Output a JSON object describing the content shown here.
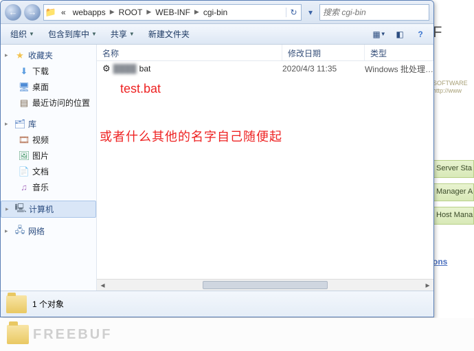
{
  "window": {
    "breadcrumb": {
      "pre": "«",
      "seg1": "webapps",
      "seg2": "ROOT",
      "seg3": "WEB-INF",
      "seg4": "cgi-bin"
    },
    "search_placeholder": "搜索 cgi-bin"
  },
  "cmdbar": {
    "organize": "组织",
    "include": "包含到库中",
    "share": "共享",
    "newfolder": "新建文件夹"
  },
  "sidebar": {
    "fav": {
      "head": "收藏夹",
      "items": [
        "下载",
        "桌面",
        "最近访问的位置"
      ]
    },
    "lib": {
      "head": "库",
      "items": [
        "视频",
        "图片",
        "文档",
        "音乐"
      ]
    },
    "computer": "计算机",
    "network": "网络"
  },
  "columns": {
    "name": "名称",
    "date": "修改日期",
    "type": "类型"
  },
  "files": [
    {
      "name": "bat",
      "date": "2020/4/3 11:35",
      "type": "Windows 批处理…"
    }
  ],
  "annotations": {
    "a1": "test.bat",
    "a2": "或者什么其他的名字自己随便起"
  },
  "status": {
    "text": "1 个对象"
  },
  "underpage": {
    "head": "F",
    "sub": "SOFTWARE\nhttp://www",
    "band1": "Server Sta",
    "band2": "Manager A",
    "band3": "Host Mana",
    "link": "ons"
  },
  "watermark": "FREEBUF"
}
